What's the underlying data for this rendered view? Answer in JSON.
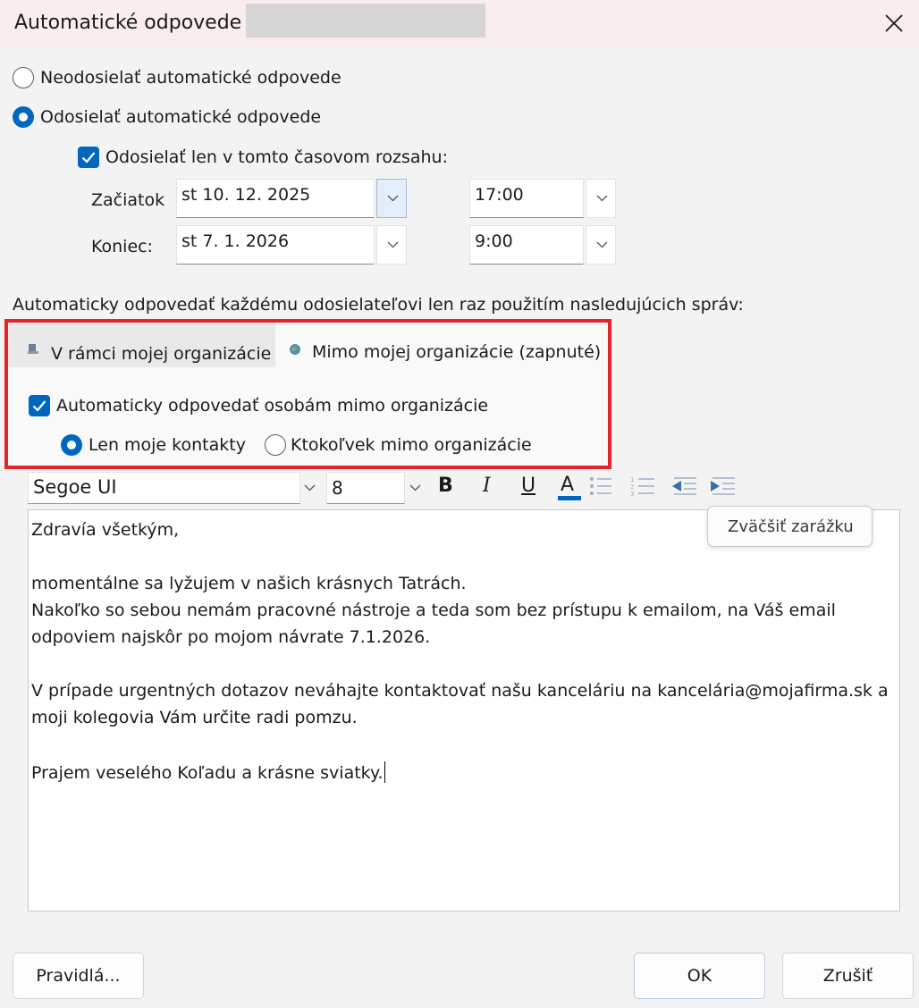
{
  "window": {
    "title": "Automatické odpovede -"
  },
  "options": {
    "no_reply_label": "Neodosielať automatické odpovede",
    "send_reply_label": "Odosielať automatické odpovede",
    "time_range_label": "Odosielať len v tomto časovom rozsahu:"
  },
  "schedule": {
    "start_label": "Začiatok",
    "start_date": "st 10. 12. 2025",
    "start_time": "17:00",
    "end_label": "Koniec:",
    "end_date": "st 7. 1. 2026",
    "end_time": "9:00"
  },
  "instruction": "Automaticky odpovedať každému odosielateľovi len raz použitím nasledujúcich správ:",
  "tabs": [
    {
      "label": "V rámci mojej organizácie",
      "icon": "inside-org-icon",
      "selected": false
    },
    {
      "label": "Mimo mojej organizácie (zapnuté)",
      "icon": "outside-org-icon",
      "selected": true
    }
  ],
  "outside": {
    "auto_reply_label": "Automaticky odpovedať osobám mimo organizácie",
    "contacts_only_label": "Len moje kontakty",
    "anyone_label": "Ktokoľvek mimo organizácie"
  },
  "toolbar": {
    "font": "Segoe UI",
    "size": "8",
    "bold": "B",
    "italic": "I",
    "underline": "U",
    "font_color": "A",
    "font_color_swatch": "#0067c0",
    "tooltip": "Zväčšiť zarážku"
  },
  "message": {
    "lines": [
      "Zdravía všetkým,",
      "",
      "momentálne sa lyžujem v našich krásnych Tatrách.",
      "Nakoľko so sebou nemám pracovné nástroje a teda som bez prístupu k emailom, na Váš email",
      "odpoviem najskôr po mojom návrate 7.1.2026.",
      "",
      "V prípade urgentných dotazov neváhajte kontaktovať našu kanceláriu na kancelária@mojafirma.sk a",
      "moji kolegovia Vám určite radi pomzu.",
      "",
      "Prajem veselého Koľadu a krásne sviatky."
    ]
  },
  "buttons": {
    "rules": "Pravidlá...",
    "ok": "OK",
    "cancel": "Zrušiť"
  },
  "colors": {
    "accent": "#0067c0",
    "highlight_frame": "#e3262e"
  }
}
